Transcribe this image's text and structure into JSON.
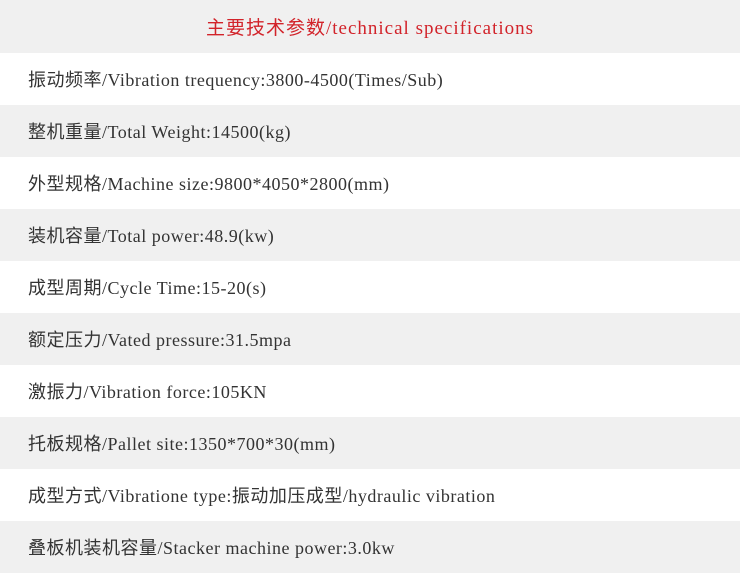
{
  "title": "主要技术参数/technical specifications",
  "specs": [
    "振动频率/Vibration trequency:3800-4500(Times/Sub)",
    "整机重量/Total Weight:14500(kg)",
    "外型规格/Machine size:9800*4050*2800(mm)",
    "装机容量/Total power:48.9(kw)",
    "成型周期/Cycle Time:15-20(s)",
    "额定压力/Vated pressure:31.5mpa",
    "激振力/Vibration force:105KN",
    "托板规格/Pallet site:1350*700*30(mm)",
    "成型方式/Vibratione type:振动加压成型/hydraulic vibration",
    "叠板机装机容量/Stacker machine power:3.0kw"
  ]
}
